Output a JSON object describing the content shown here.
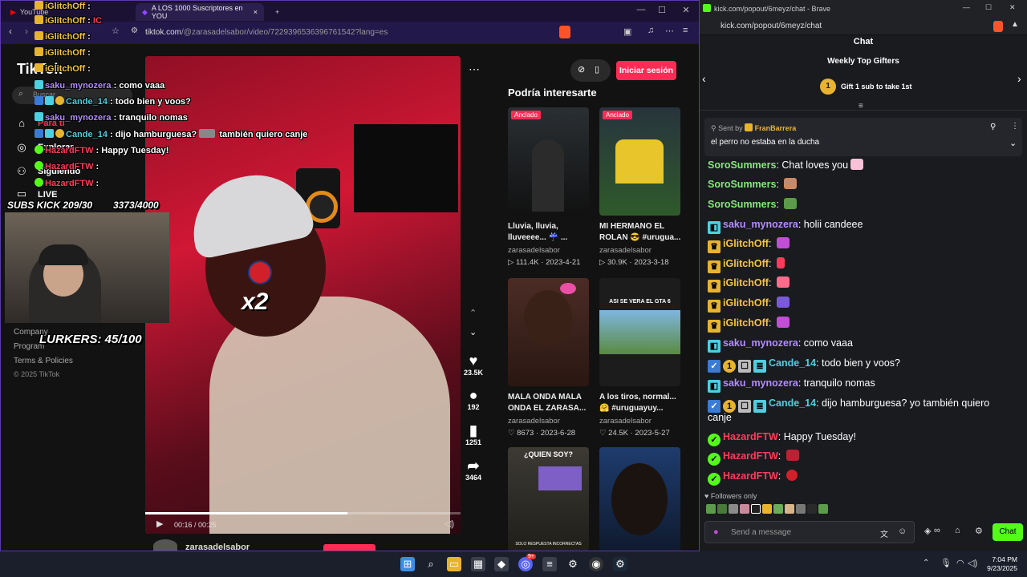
{
  "left_browser": {
    "tab_background": "YouTube",
    "tab_active_title": "A LOS 1000 Suscriptores en YOU",
    "url_host": "tiktok.com",
    "url_path": "/@zarasadelsabor/video/7229396536396761542?lang=es"
  },
  "tiktok": {
    "logo": "TikTok",
    "search_placeholder": "Buscar",
    "nav": [
      "Para ti",
      "Explorar",
      "Siguiendo",
      "LIVE"
    ],
    "footer": [
      "Company",
      "Program",
      "Terms & Policies",
      "© 2025 TikTok"
    ],
    "login_button": "Iniciar sesión",
    "video": {
      "overlay_text": "x2",
      "time": "00:16 / 00:25",
      "author": "zarasadelsabor"
    },
    "actions": {
      "likes": "23.5K",
      "comments": "192",
      "saves": "1251",
      "shares": "3464"
    },
    "recommend_title": "Podría interesarte",
    "recommendations": [
      {
        "badge": "Anclado",
        "caption_1": "Lluvia, lluvia,",
        "caption_2": "lluveeee... ☔ ...",
        "author": "zarasadelsabor",
        "stats": "▷ 111.4K · 2023-4-21"
      },
      {
        "badge": "Anclado",
        "caption_1": "MI HERMANO EL",
        "caption_2": "ROLAN 😎 #urugua...",
        "author": "zarasadelsabor",
        "stats": "▷ 30.9K · 2023-3-18"
      },
      {
        "badge": "",
        "caption_1": "MALA ONDA MALA",
        "caption_2": "ONDA EL ZARASA...",
        "author": "zarasadelsabor",
        "stats": "♡ 8673 · 2023-6-28"
      },
      {
        "badge": "",
        "caption_1": "A los tiros, normal...",
        "caption_2": "🤗 #uruguayuy...",
        "author": "zarasadelsabor",
        "stats": "♡ 24.5K · 2023-5-27"
      }
    ],
    "thumb_text_1": "ASI SE VERA EL GTA 6",
    "thumb_text_2": "¿QUIEN SOY?",
    "thumb_text_3": "SOLO RESPUESTA INCORRECTAS"
  },
  "overlay": {
    "chat": [
      {
        "user": "iGlitchOff",
        "text": ""
      },
      {
        "user": "iGlitchOff",
        "text": "IC"
      },
      {
        "user": "iGlitchOff",
        "text": ""
      },
      {
        "user": "iGlitchOff",
        "text": ""
      },
      {
        "user": "iGlitchOff",
        "text": ""
      },
      {
        "user": "saku_mynozera",
        "text": "como vaaa"
      },
      {
        "user": "Cande_14",
        "text": "todo bien y voos?"
      },
      {
        "user": "saku_mynozera",
        "text": "tranquilo nomas"
      },
      {
        "user": "Cande_14",
        "text": "dijo hamburguesa?",
        "extra": "también quiero canje"
      },
      {
        "user": "HazardFTW",
        "text": "Happy Tuesday!"
      },
      {
        "user": "HazardFTW",
        "text": ""
      },
      {
        "user": "HazardFTW",
        "text": ""
      }
    ],
    "subs": "SUBS KICK 209/30",
    "count": "3373/4000",
    "lurkers": "LURKERS: 45/100"
  },
  "right_browser": {
    "title": "kick.com/popout/6meyz/chat - Brave",
    "url": "kick.com/popout/6meyz/chat"
  },
  "kick_chat": {
    "header": "Chat",
    "gifters_title": "Weekly Top Gifters",
    "gift_rank": "1",
    "gift_text": "Gift 1 sub to take 1st",
    "pinned_sent_by": "Sent by",
    "pinned_user": "FranBarrera",
    "pinned_message": "el perro no estaba en la ducha",
    "messages": [
      {
        "user": "SoroSummers",
        "text": "Chat loves you",
        "color": "#86e87a"
      },
      {
        "user": "SoroSummers",
        "text": "",
        "color": "#86e87a"
      },
      {
        "user": "SoroSummers",
        "text": "",
        "color": "#86e87a"
      },
      {
        "user": "saku_mynozera",
        "text": "holii candeee",
        "color": "#b48cff"
      },
      {
        "user": "iGlitchOff",
        "text": "",
        "color": "#f5c542"
      },
      {
        "user": "iGlitchOff",
        "text": "",
        "color": "#f5c542"
      },
      {
        "user": "iGlitchOff",
        "text": "",
        "color": "#f5c542"
      },
      {
        "user": "iGlitchOff",
        "text": "",
        "color": "#f5c542"
      },
      {
        "user": "iGlitchOff",
        "text": "",
        "color": "#f5c542"
      },
      {
        "user": "saku_mynozera",
        "text": "como vaaa",
        "color": "#b48cff"
      },
      {
        "user": "Cande_14",
        "text": "todo bien y voos?",
        "color": "#4dd0e1"
      },
      {
        "user": "saku_mynozera",
        "text": "tranquilo nomas",
        "color": "#b48cff"
      },
      {
        "user": "Cande_14",
        "text": "dijo hamburguesa? yo también quiero",
        "color": "#4dd0e1",
        "wrap": "canje"
      },
      {
        "user": "HazardFTW",
        "text": "Happy Tuesday!",
        "color": "#ff3b5c"
      },
      {
        "user": "HazardFTW",
        "text": "",
        "color": "#ff3b5c"
      },
      {
        "user": "HazardFTW",
        "text": "",
        "color": "#ff3b5c"
      }
    ],
    "followers_only": "Followers only",
    "send_placeholder": "Send a message",
    "chat_button": "Chat"
  },
  "taskbar": {
    "time": "7:04 PM",
    "date": "9/23/2025",
    "notification_count": "9+"
  },
  "colors": {
    "tiktok_accent": "#fe2c55",
    "kick_accent": "#53fc18",
    "gifter_gold": "#e8b430"
  }
}
